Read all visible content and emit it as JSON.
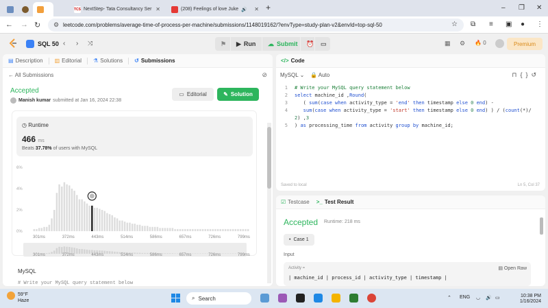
{
  "browser": {
    "tabs": [
      {
        "label": "",
        "icon": "screen-icon"
      },
      {
        "label": "",
        "icon": "leetcode-icon"
      },
      {
        "label": "NextStep- Tata Consultancy Ser",
        "icon": "tcs-icon"
      },
      {
        "label": "(208) Feelings of love Juke",
        "icon": "youtube-icon"
      }
    ],
    "url": "leetcode.com/problems/average-time-of-process-per-machine/submissions/1148019162/?envType=study-plan-v2&envId=top-sql-50",
    "new_tab": "+",
    "win_min": "–",
    "win_max": "⌄",
    "win_close": "✕"
  },
  "lc": {
    "study_plan": "SQL 50",
    "run": "Run",
    "submit": "Submit",
    "streak": "0",
    "premium": "Premium"
  },
  "left": {
    "tabs": [
      "Description",
      "Editorial",
      "Solutions",
      "Submissions"
    ],
    "back": "All Submissions",
    "status": "Accepted",
    "author": "Manish kumar",
    "submitted": "submitted at Jan 16, 2024 22:38",
    "editorial_btn": "Editorial",
    "solution_btn": "Solution",
    "runtime_label": "Runtime",
    "runtime_value": "466",
    "runtime_unit": "ms",
    "beats_pct": "37.78%",
    "beats_prefix": "Beats",
    "beats_suffix": "of users with MySQL",
    "lang": "MySQL",
    "code_peek": "# Write your MySQL query statement below"
  },
  "chart_data": {
    "type": "bar",
    "yticks": [
      "6%",
      "4%",
      "2%",
      "0%"
    ],
    "xticks": [
      "301ms",
      "372ms",
      "443ms",
      "514ms",
      "586ms",
      "657ms",
      "726ms",
      "799ms"
    ],
    "highlight_value_ms": 466,
    "values": [
      0.2,
      0.2,
      0.3,
      0.3,
      0.4,
      0.4,
      0.6,
      1.2,
      2.0,
      3.6,
      4.4,
      4.2,
      4.6,
      4.4,
      4.3,
      4.0,
      3.8,
      3.4,
      3.0,
      3.0,
      2.8,
      2.6,
      2.4,
      2.4,
      2.2,
      2.2,
      2.1,
      2.0,
      1.9,
      1.7,
      1.6,
      1.5,
      1.3,
      1.2,
      1.0,
      1.0,
      0.9,
      0.8,
      0.8,
      0.7,
      0.7,
      0.6,
      0.6,
      0.5,
      0.5,
      0.5,
      0.4,
      0.4,
      0.4,
      0.4,
      0.3,
      0.3,
      0.3,
      0.3,
      0.3,
      0.3,
      0.2,
      0.2,
      0.2,
      0.2,
      0.2,
      0.2,
      0.2,
      0.2,
      0.2,
      0.2,
      0.2,
      0.2,
      0.2,
      0.2,
      0.2,
      0.2,
      0.2,
      0.2,
      0.2,
      0.2,
      0.2,
      0.2,
      0.2,
      0.2,
      0.2,
      0.2,
      0.2,
      0.2,
      0.2,
      0.2
    ],
    "highlight_index": 23,
    "ylim": [
      0,
      6
    ]
  },
  "right": {
    "code_title": "Code",
    "lang": "MySQL",
    "auto": "Auto",
    "saved": "Saved to local",
    "cursor": "Ln 5, Col 37",
    "code_lines": [
      "# Write your MySQL query statement below",
      "select machine_id ,Round(",
      "   ( sum(case when activity_type = 'end' then timestamp else 0 end) -",
      "   sum(case when activity_type = 'start' then timestamp else 0 end) ) / (count(*)/",
      "2) ,3",
      ") as processing_time from activity group by machine_id;"
    ],
    "line_numbers": [
      "1",
      "2",
      "3",
      "4",
      "",
      "5"
    ],
    "testcase_tab": "Testcase",
    "result_tab": "Test Result",
    "result_status": "Accepted",
    "result_runtime": "Runtime: 218 ms",
    "case_label": "Case 1",
    "input_label": "Input",
    "activity_label": "Activity =",
    "open_raw": "Open Raw",
    "table_header": "| machine_id | process_id | activity_type | timestamp |"
  },
  "taskbar": {
    "temp": "59°F",
    "weather": "Haze",
    "search": "Search",
    "lang": "ENG",
    "time": "10:38 PM",
    "date": "1/16/2024",
    "apps_colors": [
      "#5b9bd5",
      "#9b59b6",
      "#222222",
      "#1e88e5",
      "#f4b400",
      "#2e7d32",
      "#db4437"
    ]
  }
}
